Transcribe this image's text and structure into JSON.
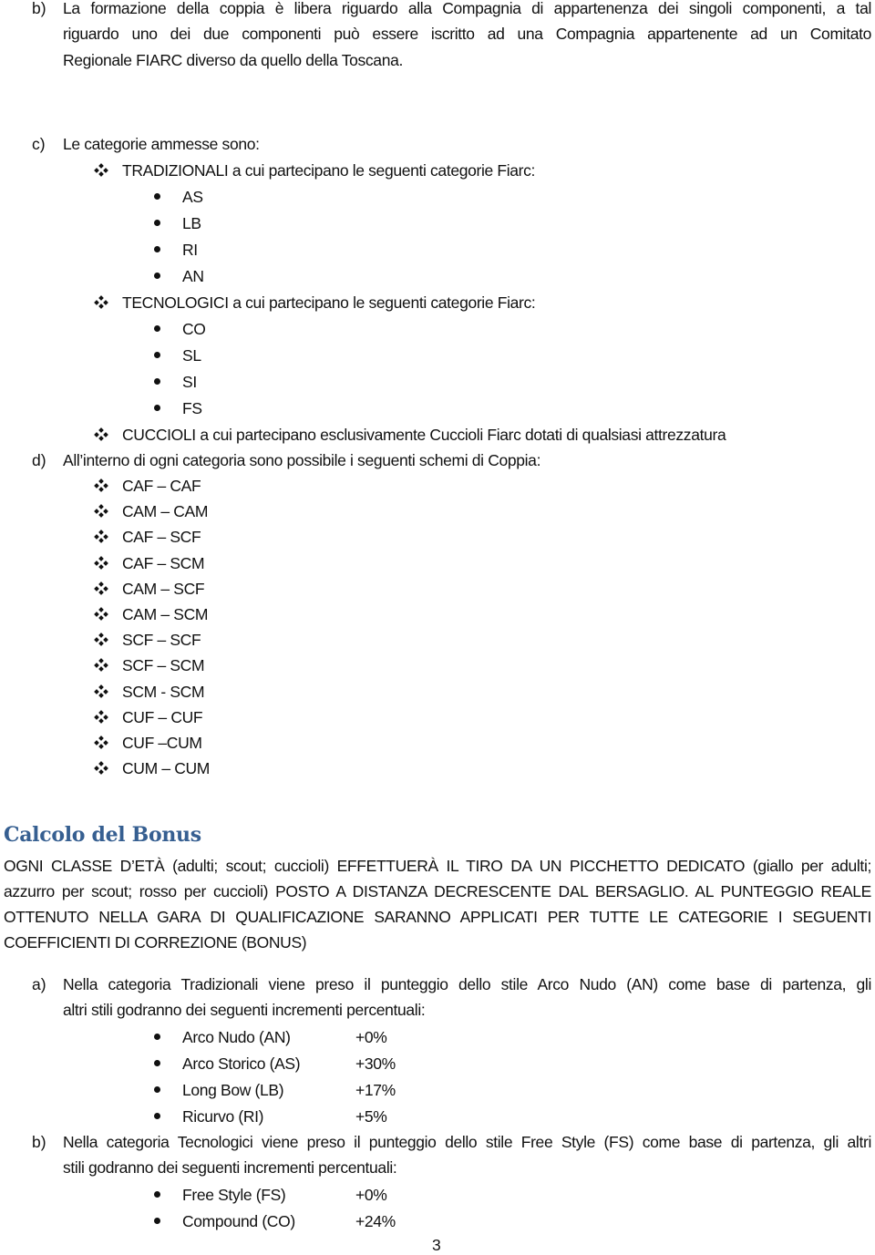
{
  "section_b": {
    "marker": "b)",
    "lines": [
      "La formazione della coppia è libera riguardo alla Compagnia di appartenenza dei singoli componenti, a tal",
      "riguardo uno dei due componenti può essere iscritto ad una Compagnia appartenente ad un  Comitato",
      "Regionale FIARC diverso da quello della Toscana."
    ]
  },
  "section_c": {
    "marker": "c)",
    "intro": "Le categorie ammesse sono:",
    "groups": [
      {
        "label": "TRADIZIONALI a cui partecipano le seguenti categorie Fiarc:",
        "items": [
          "AS",
          "LB",
          "RI",
          "AN"
        ]
      },
      {
        "label": "TECNOLOGICI  a cui partecipano le seguenti categorie Fiarc:",
        "items": [
          "CO",
          "SL",
          "SI",
          "FS"
        ]
      },
      {
        "label": "CUCCIOLI  a cui partecipano esclusivamente Cuccioli Fiarc dotati di qualsiasi attrezzatura",
        "items": []
      }
    ]
  },
  "section_d": {
    "marker": "d)",
    "intro": "All’interno di ogni categoria sono possibile i seguenti schemi di Coppia:",
    "schemes": [
      "CAF – CAF",
      "CAM – CAM",
      "CAF – SCF",
      "CAF – SCM",
      "CAM – SCF",
      "CAM – SCM",
      "SCF – SCF",
      "SCF – SCM",
      "SCM - SCM",
      "CUF – CUF",
      "CUF –CUM",
      "CUM – CUM"
    ]
  },
  "bonus": {
    "heading": "Calcolo del Bonus",
    "heading_color": "#365f91",
    "paragraph_lines": [
      "OGNI CLASSE D’ETÀ (adulti; scout; cuccioli) EFFETTUERÀ IL TIRO DA UN PICCHETTO DEDICATO (giallo per adulti;",
      "azzurro per scout; rosso per cuccioli) POSTO A DISTANZA DECRESCENTE DAL BERSAGLIO. AL PUNTEGGIO REALE",
      "OTTENUTO NELLA GARA DI QUALIFICAZIONE SARANNO APPLICATI PER TUTTE LE CATEGORIE I SEGUENTI",
      "COEFFICIENTI DI CORREZIONE (BONUS)"
    ],
    "rules": [
      {
        "marker": "a)",
        "lines": [
          "Nella categoria Tradizionali viene preso il punteggio dello stile Arco Nudo (AN) come base di partenza, gli",
          "altri stili godranno dei seguenti incrementi percentuali:"
        ],
        "increments": [
          {
            "style": "Arco Nudo (AN)",
            "value": "+0%"
          },
          {
            "style": "Arco Storico (AS)",
            "value": "+30%"
          },
          {
            "style": "Long Bow (LB)",
            "value": "+17%"
          },
          {
            "style": "Ricurvo (RI)",
            "value": "+5%"
          }
        ]
      },
      {
        "marker": "b)",
        "lines": [
          "Nella categoria Tecnologici viene preso il punteggio dello stile Free Style (FS) come base di partenza, gli altri",
          "stili godranno dei seguenti incrementi percentuali:"
        ],
        "increments": [
          {
            "style": "Free Style (FS)",
            "value": "+0%"
          },
          {
            "style": "Compound (CO)",
            "value": "+24%"
          }
        ]
      }
    ]
  },
  "footer": {
    "page_number": "3"
  }
}
